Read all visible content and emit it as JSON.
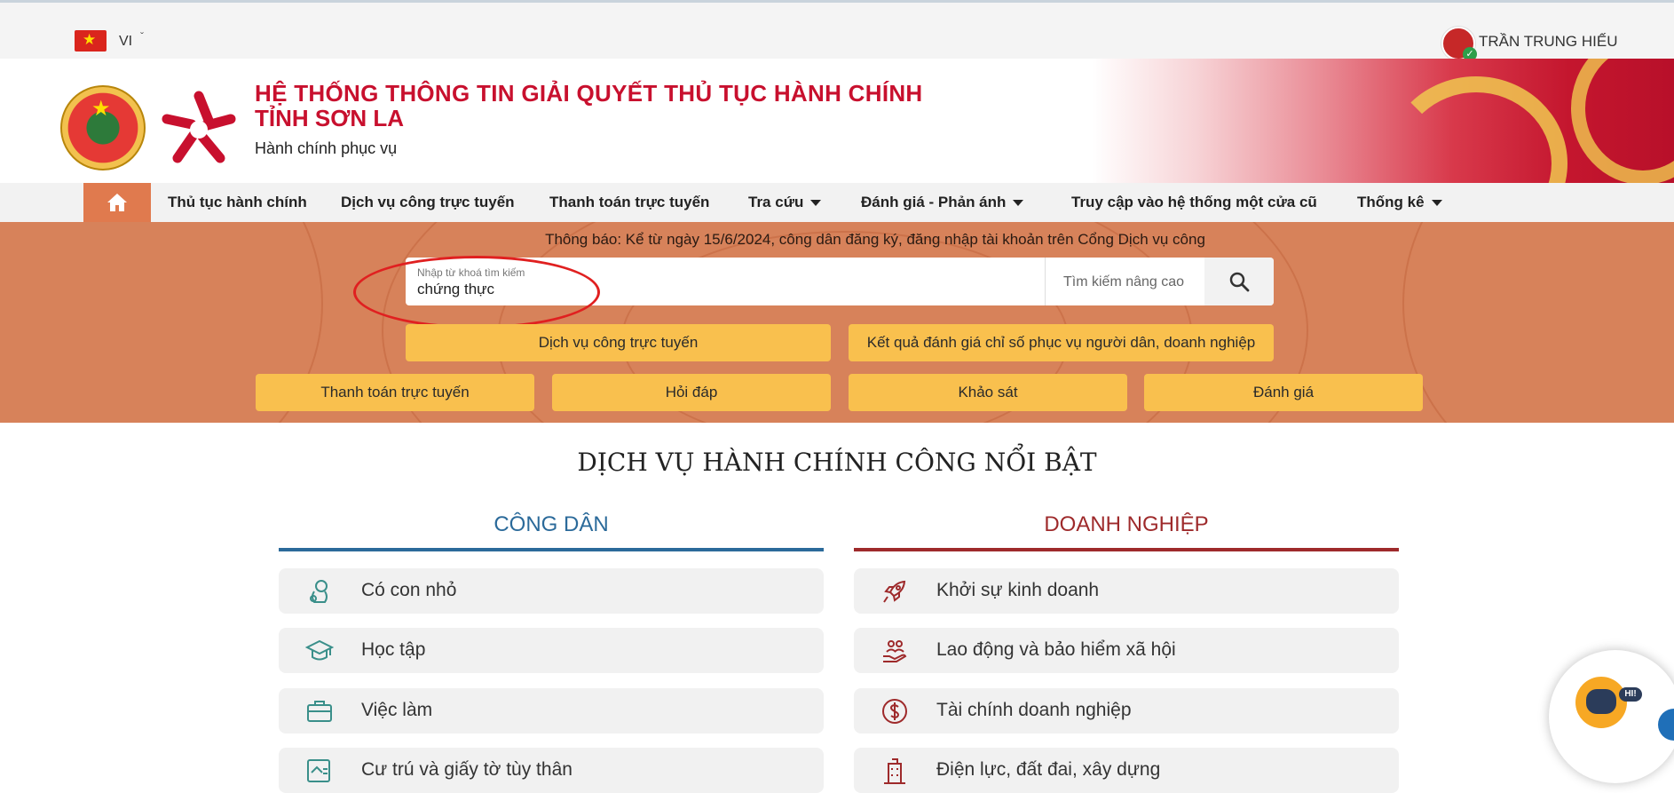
{
  "topbar": {
    "language": "VI",
    "user_name": "TRẦN TRUNG HIẾU"
  },
  "header": {
    "title_line1": "HỆ THỐNG THÔNG TIN GIẢI QUYẾT THỦ TỤC HÀNH CHÍNH",
    "title_line2": "TỈNH SƠN LA",
    "subtitle": "Hành chính phục vụ"
  },
  "nav": {
    "items": [
      {
        "label": "Thủ tục hành chính",
        "dropdown": false
      },
      {
        "label": "Dịch vụ công trực tuyến",
        "dropdown": false
      },
      {
        "label": "Thanh toán trực tuyến",
        "dropdown": false
      },
      {
        "label": "Tra cứu",
        "dropdown": true
      },
      {
        "label": "Đánh giá - Phản ánh",
        "dropdown": true
      },
      {
        "label": "Truy cập vào hệ thống một cửa cũ",
        "dropdown": false
      },
      {
        "label": "Thống kê",
        "dropdown": true
      }
    ]
  },
  "hero": {
    "notice": "Thông báo: Kể từ ngày 15/6/2024, công dân đăng ký, đăng nhập tài khoản trên Cổng Dịch vụ công",
    "search": {
      "label": "Nhập từ khoá tìm kiếm",
      "value": "chứng thực",
      "advanced_label": "Tìm kiếm nâng cao"
    },
    "buttons_row1": [
      "Dịch vụ công trực tuyến",
      "Kết quả đánh giá chỉ số phục vụ người dân, doanh nghiệp"
    ],
    "buttons_row2": [
      "Thanh toán trực tuyến",
      "Hỏi đáp",
      "Khảo sát",
      "Đánh giá"
    ]
  },
  "featured": {
    "title": "DỊCH VỤ HÀNH CHÍNH CÔNG NỔI BẬT",
    "citizen": {
      "title": "CÔNG DÂN",
      "color": "#2b6a9a",
      "items": [
        {
          "label": "Có con nhỏ",
          "icon": "baby-icon"
        },
        {
          "label": "Học tập",
          "icon": "graduation-cap-icon"
        },
        {
          "label": "Việc làm",
          "icon": "briefcase-icon"
        },
        {
          "label": "Cư trú và giấy tờ tùy thân",
          "icon": "id-card-icon"
        }
      ]
    },
    "business": {
      "title": "DOANH NGHIỆP",
      "color": "#9e2a2b",
      "items": [
        {
          "label": "Khởi sự kinh doanh",
          "icon": "rocket-icon"
        },
        {
          "label": "Lao động và bảo hiểm xã hội",
          "icon": "hand-people-icon"
        },
        {
          "label": "Tài chính doanh nghiệp",
          "icon": "dollar-icon"
        },
        {
          "label": "Điện lực, đất đai, xây dựng",
          "icon": "building-icon"
        }
      ]
    }
  },
  "chatbot": {
    "badge": "HI!"
  }
}
